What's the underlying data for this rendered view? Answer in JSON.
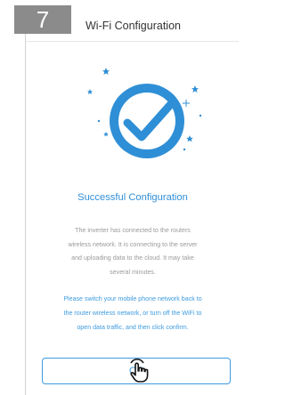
{
  "step": {
    "number": "7"
  },
  "header": {
    "title": "Wi-Fi Configuration"
  },
  "illustration": {
    "icon": "check-mark-icon",
    "accent_color": "#2f8fd6"
  },
  "success": {
    "title": "Successful Configuration"
  },
  "description": {
    "lines": [
      "The inverter has connected to the routers",
      "wireless network. It is connecting to the server",
      "and uploading data to the cloud. It may take",
      "several minutes."
    ]
  },
  "notice": {
    "lines": [
      "Please switch your mobile phone network back to",
      "the router wireless network, or turn off the WiFi to",
      "open data traffic, and then click confirm."
    ]
  },
  "ok_button": {
    "label": "OK"
  },
  "colors": {
    "accent": "#3d9be0",
    "badge": "#8b8b8b",
    "muted_text": "#9a9a9a"
  }
}
